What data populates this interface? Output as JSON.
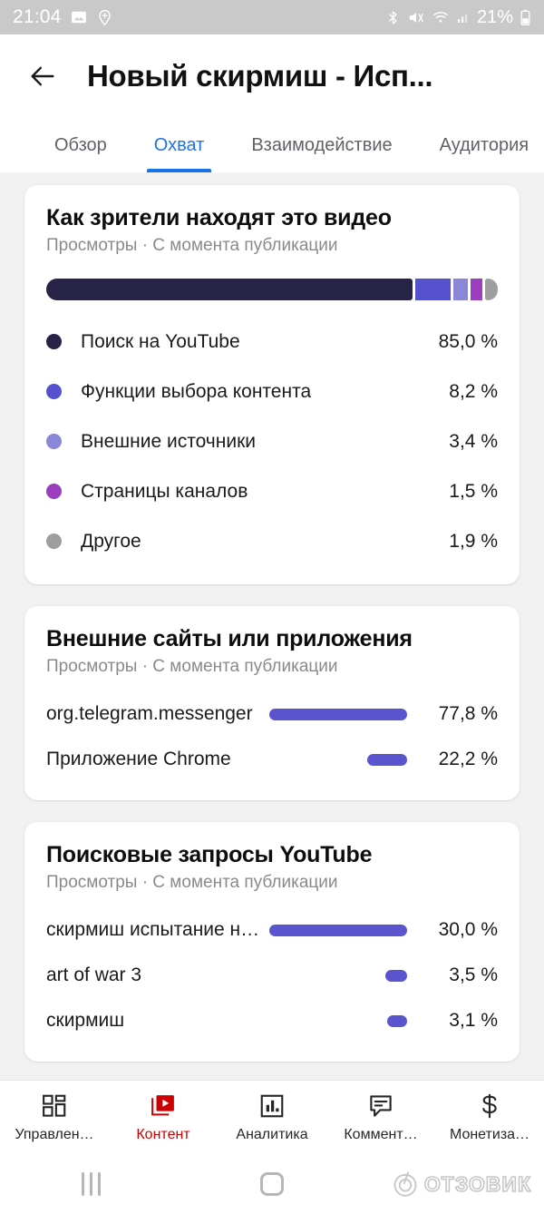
{
  "statusbar": {
    "time": "21:04",
    "battery": "21%",
    "icons_left": [
      "photo-icon",
      "location-add-icon"
    ],
    "icons_right": [
      "bluetooth-icon",
      "mute-icon",
      "wifi-icon",
      "signal-icon",
      "battery-icon"
    ]
  },
  "appbar": {
    "back_icon": "back-arrow-icon",
    "title": "Новый скирмиш - Исп..."
  },
  "tabs": [
    {
      "label": "Обзор",
      "active": false
    },
    {
      "label": "Охват",
      "active": true
    },
    {
      "label": "Взаимодействие",
      "active": false
    },
    {
      "label": "Аудитория",
      "active": false
    }
  ],
  "colors": {
    "accent_tab": "#1a73e8",
    "bar_purple": "#5a55cf",
    "brand_red": "#cc0000",
    "page_bg": "#f1f1f1"
  },
  "cards": [
    {
      "title": "Как зрители находят это видео",
      "subtitle": "Просмотры · С момента публикации",
      "type": "stacked-legend",
      "legend": [
        {
          "label": "Поиск на YouTube",
          "value": "85,0 %",
          "color": "#262347"
        },
        {
          "label": "Функции выбора контента",
          "value": "8,2 %",
          "color": "#5551cd"
        },
        {
          "label": "Внешние источники",
          "value": "3,4 %",
          "color": "#8b87d8"
        },
        {
          "label": "Страницы каналов",
          "value": "1,5 %",
          "color": "#9c3ec0"
        },
        {
          "label": "Другое",
          "value": "1,9 %",
          "color": "#9e9e9e"
        }
      ]
    },
    {
      "title": "Внешние сайты или приложения",
      "subtitle": "Просмотры · С момента публикации",
      "type": "hbar",
      "rows": [
        {
          "label": "org.telegram.messenger",
          "value": "77,8 %"
        },
        {
          "label": "Приложение Chrome",
          "value": "22,2 %"
        }
      ]
    },
    {
      "title": "Поисковые запросы YouTube",
      "subtitle": "Просмотры · С момента публикации",
      "type": "hbar",
      "rows": [
        {
          "label": "скирмиш испытание н…",
          "value": "30,0 %"
        },
        {
          "label": "art of war 3",
          "value": "3,5 %"
        },
        {
          "label": "скирмиш",
          "value": "3,1 %"
        }
      ]
    }
  ],
  "bottomnav": [
    {
      "label": "Управлен…",
      "icon": "dashboard-icon",
      "active": false
    },
    {
      "label": "Контент",
      "icon": "video-stack-icon",
      "active": true
    },
    {
      "label": "Аналитика",
      "icon": "bar-chart-icon",
      "active": false
    },
    {
      "label": "Коммент…",
      "icon": "comment-icon",
      "active": false
    },
    {
      "label": "Монетиза…",
      "icon": "dollar-icon",
      "active": false
    }
  ],
  "sysnav": {
    "recents_icon": "recents-icon",
    "home_icon": "home-icon",
    "watermark": "ОТЗОВИК"
  },
  "chart_data": [
    {
      "type": "bar",
      "title": "Как зрители находят это видео",
      "subtitle": "Просмотры · С момента публикации",
      "orientation": "stacked-horizontal",
      "unit": "%",
      "categories": [
        "Поиск на YouTube",
        "Функции выбора контента",
        "Внешние источники",
        "Страницы каналов",
        "Другое"
      ],
      "values": [
        85.0,
        8.2,
        3.4,
        1.5,
        1.9
      ],
      "labels": [
        "85,0 %",
        "8,2 %",
        "3,4 %",
        "1,5 %",
        "1,9 %"
      ],
      "colors": [
        "#262347",
        "#5551cd",
        "#8b87d8",
        "#9c3ec0",
        "#9e9e9e"
      ],
      "legend_position": "below",
      "grid": false
    },
    {
      "type": "bar",
      "title": "Внешние сайты или приложения",
      "subtitle": "Просмотры · С момента публикации",
      "orientation": "horizontal",
      "unit": "%",
      "categories": [
        "org.telegram.messenger",
        "Приложение Chrome"
      ],
      "values": [
        77.8,
        22.2
      ],
      "labels": [
        "77,8 %",
        "22,2 %"
      ],
      "color": "#5a55cf",
      "grid": false
    },
    {
      "type": "bar",
      "title": "Поисковые запросы YouTube",
      "subtitle": "Просмотры · С момента публикации",
      "orientation": "horizontal",
      "unit": "%",
      "categories": [
        "скирмиш испытание н…",
        "art of war 3",
        "скирмиш"
      ],
      "values": [
        30.0,
        3.5,
        3.1
      ],
      "labels": [
        "30,0 %",
        "3,5 %",
        "3,1 %"
      ],
      "color": "#5a55cf",
      "grid": false
    }
  ]
}
